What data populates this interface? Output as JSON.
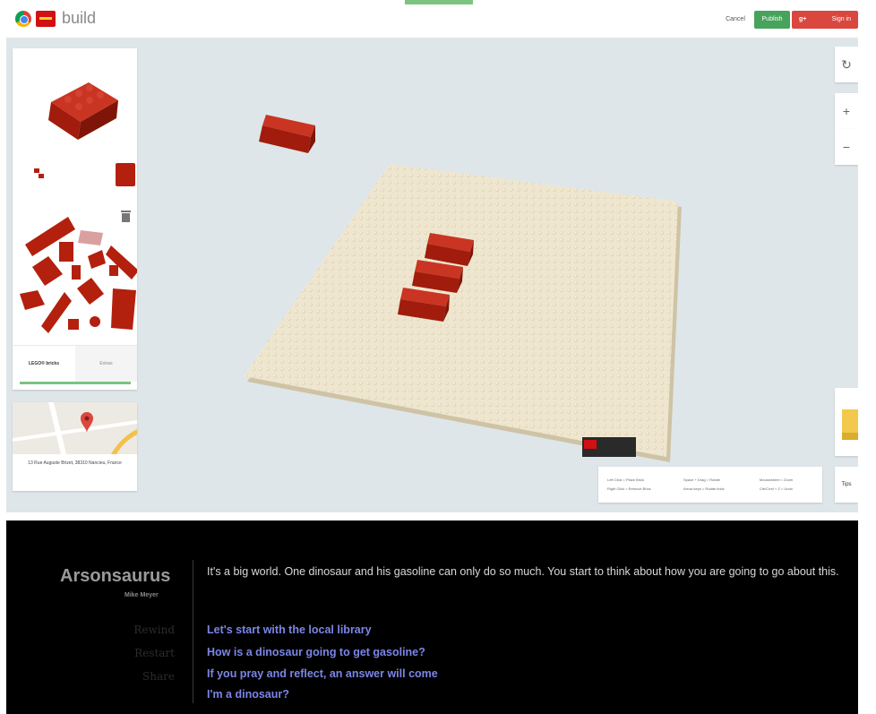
{
  "build": {
    "app_title": "build",
    "cancel_label": "Cancel",
    "publish_label": "Publish",
    "signin_g": "g+",
    "signin_label": "Sign in",
    "palette": {
      "tab_lego": "LEGO® bricks",
      "tab_extras": "Extras"
    },
    "location": {
      "address": "13 Rue Auguste Brizet, 38310 Nancieu, France"
    },
    "reset_label": "↻",
    "zoom_in_label": "+",
    "zoom_out_label": "−",
    "tips_label": "Tips",
    "help": [
      "Left Click = Place Brick",
      "Right Click = Remove Brick",
      "Space + Drag = Rotate",
      "Arrow keys = Rotate brick",
      "Mousewheel = Zoom",
      "Ctrl/Cmd + Z = Undo"
    ],
    "colors": {
      "brick": "#b3200e",
      "baseplate": "#efe6cf",
      "accent_green": "#47a35c",
      "accent_red": "#d9473f"
    }
  },
  "story": {
    "title": "Arsonsaurus",
    "author": "Mike Meyer",
    "nav": {
      "rewind": "Rewind",
      "restart": "Restart",
      "share": "Share"
    },
    "text": "It's a big world. One dinosaur and his gasoline can only do so much. You start to think about how you are going to go about this.",
    "choices": [
      "Let's start with the local library",
      "How is a dinosaur going to get gasoline?",
      "If you pray and reflect, an answer will come",
      "I'm a dinosaur?"
    ]
  }
}
